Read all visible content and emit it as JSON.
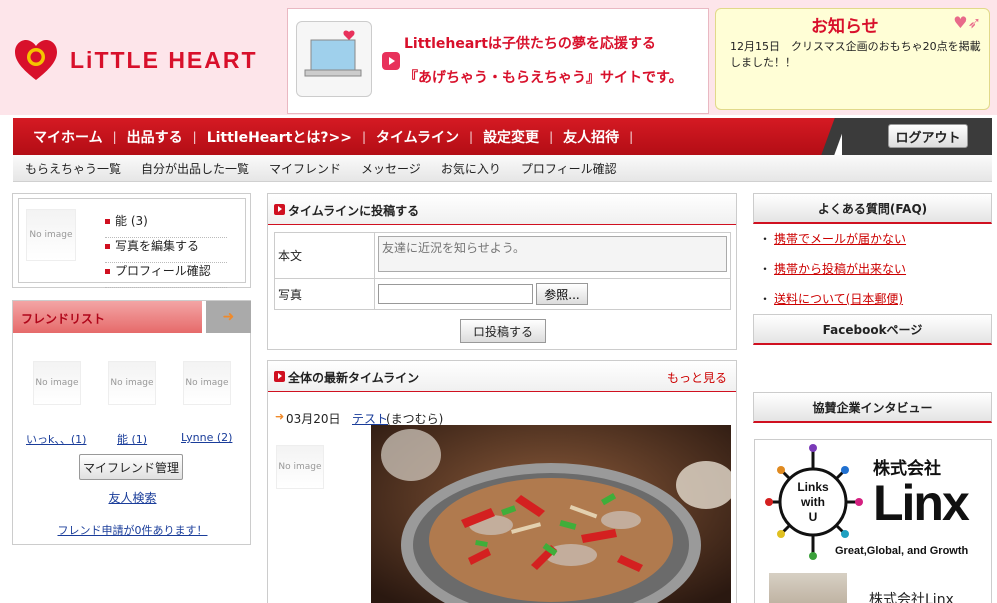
{
  "header": {
    "logo_text": "LiTTLE HEART",
    "banner": {
      "line1": "Littleheartは子供たちの夢を応援する",
      "line2": "『あげちゃう・もらえちゃう』サイトです。"
    },
    "notice": {
      "title": "お知らせ",
      "text": "12月15日　クリスマス企画のおもちゃ20点を掲載しました！！"
    }
  },
  "mainnav": {
    "items": [
      "マイホーム",
      "出品する",
      "LittleHeartとは?>>",
      "タイムライン",
      "設定変更",
      "友人招待"
    ],
    "logout": "ログアウト"
  },
  "subnav": {
    "items": [
      "もらえちゃう一覧",
      "自分が出品した一覧",
      "マイフレンド",
      "メッセージ",
      "お気に入り",
      "プロフィール確認"
    ]
  },
  "profile": {
    "no_image": "No image",
    "links": [
      "能 (3)",
      "写真を編集する",
      "プロフィール確認"
    ]
  },
  "friends": {
    "title": "フレンドリスト",
    "arrow": "➜",
    "no_image": "No image",
    "list": [
      {
        "name": "いっk、、(1)"
      },
      {
        "name": "能 (1)"
      },
      {
        "name": "Lynne (2)"
      }
    ],
    "manage_button": "マイフレンド管理",
    "search_link": "友人検索",
    "request_link": "フレンド申請が0件あります！"
  },
  "post": {
    "title": "タイムラインに投稿する",
    "body_label": "本文",
    "body_placeholder": "友達に近況を知らせよう。",
    "photo_label": "写真",
    "browse_button": "参照...",
    "submit_button": "ロ投稿する"
  },
  "timeline": {
    "title": "全体の最新タイムライン",
    "more": "もっと見る",
    "no_image": "No image",
    "entry": {
      "date": "03月20日",
      "user": "テスト",
      "user_sub": "(まつむら)"
    }
  },
  "sidebar": {
    "faq_title": "よくある質問(FAQ)",
    "faq_items": [
      "携帯でメールが届かない",
      "携帯から投稿が出来ない",
      "送料について(日本郵便)"
    ],
    "facebook_title": "Facebookページ",
    "interview_title": "協賛企業インタビュー",
    "sponsor": {
      "company_prefix": "株式会社",
      "company_name": "Linx",
      "logo_text": [
        "Links",
        "with",
        "U"
      ],
      "tagline": "Great,Global, and Growth",
      "caption": "株式会社Linx"
    }
  },
  "colors": {
    "brand_red": "#d51a23",
    "header_pink": "#fde5ea",
    "link_blue": "#1a3d9a"
  }
}
